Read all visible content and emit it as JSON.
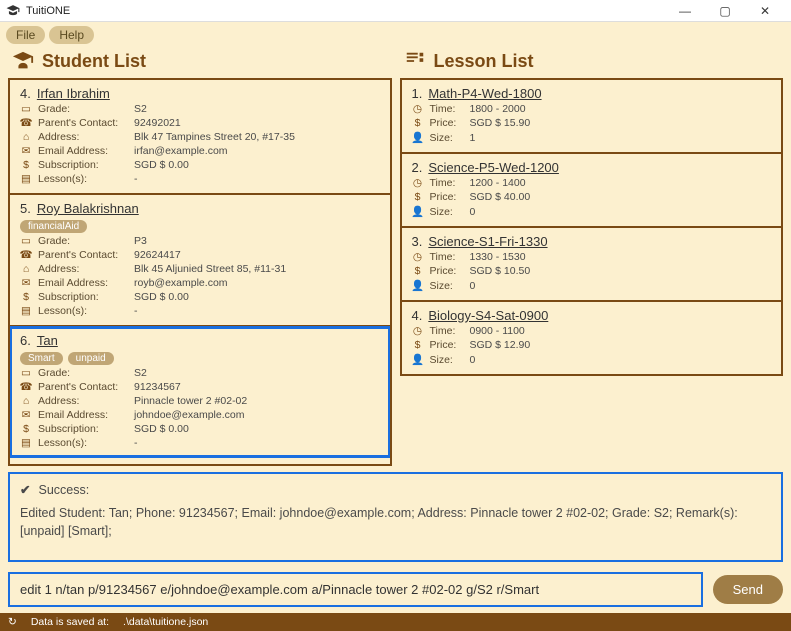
{
  "window": {
    "title": "TuitiONE",
    "min": "—",
    "max": "▢",
    "close": "✕"
  },
  "menu": {
    "file": "File",
    "help": "Help"
  },
  "panes": {
    "student_title": "Student List",
    "lesson_title": "Lesson List"
  },
  "students": [
    {
      "idx": "4.",
      "name": "Irfan Ibrahim",
      "tags": [],
      "grade": "S2",
      "parent": "92492021",
      "address": "Blk 47 Tampines Street 20, #17-35",
      "email": "irfan@example.com",
      "subscription": "SGD $ 0.00",
      "lessons": "-",
      "selected": false
    },
    {
      "idx": "5.",
      "name": "Roy Balakrishnan",
      "tags": [
        "financialAid"
      ],
      "grade": "P3",
      "parent": "92624417",
      "address": "Blk 45 Aljunied Street 85, #11-31",
      "email": "royb@example.com",
      "subscription": "SGD $ 0.00",
      "lessons": "-",
      "selected": false
    },
    {
      "idx": "6.",
      "name": "Tan",
      "tags": [
        "Smart",
        "unpaid"
      ],
      "grade": "S2",
      "parent": "91234567",
      "address": "Pinnacle tower 2 #02-02",
      "email": "johndoe@example.com",
      "subscription": "SGD $ 0.00",
      "lessons": "-",
      "selected": true
    }
  ],
  "lessons": [
    {
      "idx": "1.",
      "name": "Math-P4-Wed-1800",
      "time": "1800 - 2000",
      "price": "SGD $ 15.90",
      "size": "1"
    },
    {
      "idx": "2.",
      "name": "Science-P5-Wed-1200",
      "time": "1200 - 1400",
      "price": "SGD $ 40.00",
      "size": "0"
    },
    {
      "idx": "3.",
      "name": "Science-S1-Fri-1330",
      "time": "1330 - 1530",
      "price": "SGD $ 10.50",
      "size": "0"
    },
    {
      "idx": "4.",
      "name": "Biology-S4-Sat-0900",
      "time": "0900 - 1100",
      "price": "SGD $ 12.90",
      "size": "0"
    }
  ],
  "field_labels": {
    "grade": "Grade:",
    "parent": "Parent's Contact:",
    "address": "Address:",
    "email": "Email Address:",
    "subscription": "Subscription:",
    "lessons": "Lesson(s):",
    "time": "Time:",
    "price": "Price:",
    "size": "Size:"
  },
  "result": {
    "status": "Success:",
    "body": "Edited Student: Tan; Phone: 91234567; Email: johndoe@example.com; Address: Pinnacle tower 2 #02-02; Grade: S2; Remark(s): [unpaid] [Smart];"
  },
  "command": {
    "value": "edit 1 n/tan p/91234567 e/johndoe@example.com a/Pinnacle tower 2 #02-02 g/S2 r/Smart",
    "send_label": "Send"
  },
  "status": {
    "prefix_icon": "↻",
    "label": "Data is saved at:",
    "path": ".\\data\\tuitione.json"
  }
}
